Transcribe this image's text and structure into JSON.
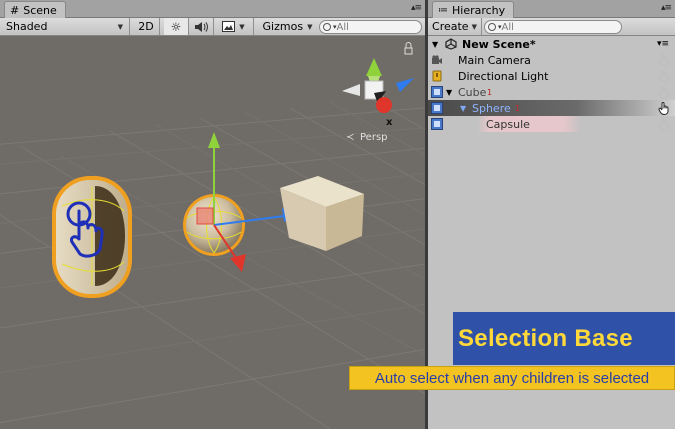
{
  "scene": {
    "tab_label": "Scene",
    "shading_mode": "Shaded",
    "mode_2d": "2D",
    "gizmos_label": "Gizmos",
    "search_placeholder": "All",
    "persp_label": "Persp",
    "axis_x_label": "x"
  },
  "hierarchy": {
    "tab_label": "Hierarchy",
    "create_label": "Create",
    "search_placeholder": "All",
    "scene_name": "New Scene*",
    "items": [
      {
        "label": "Main Camera",
        "depth": 0,
        "icon": "camera-icon"
      },
      {
        "label": "Directional Light",
        "depth": 0,
        "icon": "light-icon"
      },
      {
        "label": "Cube",
        "depth": 0,
        "icon": "prefab-icon",
        "marker": "1",
        "expanded": true
      },
      {
        "label": "Sphere",
        "depth": 1,
        "icon": "prefab-icon",
        "marker": "1",
        "expanded": true,
        "selected": true
      },
      {
        "label": "Capsule",
        "depth": 2,
        "icon": "prefab-icon"
      }
    ]
  },
  "overlay": {
    "title": "Selection Base",
    "subtitle": "Auto select when any children is selected"
  },
  "colors": {
    "selection_outline": "#f0a020",
    "overlay_title_bg": "#2f52a8",
    "overlay_title_text": "#ffd83a",
    "overlay_sub_bg": "#f3c321",
    "overlay_sub_text": "#2a3ea8",
    "axis_x": "#e0352a",
    "axis_y": "#8fd23c",
    "axis_z": "#2f7cf0"
  }
}
